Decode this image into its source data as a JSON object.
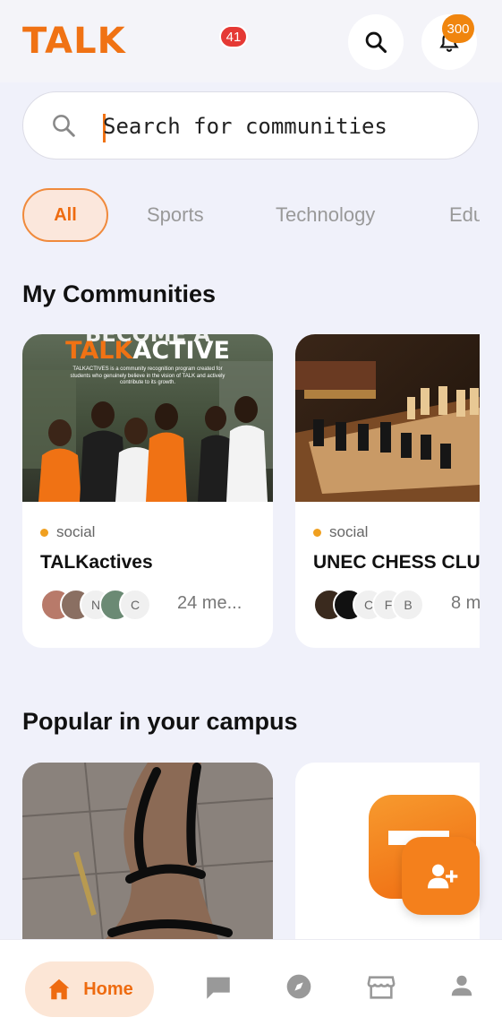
{
  "app": {
    "logo": "TALK"
  },
  "header": {
    "notification_count": "300"
  },
  "search": {
    "placeholder": "Search for communities"
  },
  "chips": [
    {
      "label": "All",
      "active": true
    },
    {
      "label": "Sports"
    },
    {
      "label": "Technology"
    },
    {
      "label": "Edu"
    }
  ],
  "sections": {
    "my_communities": "My Communities",
    "popular": "Popular in your campus"
  },
  "my_communities": [
    {
      "category": "social",
      "name": "TALKactives",
      "avatar_letters": [
        "",
        "",
        "N",
        "",
        "C"
      ],
      "members": "24 me...",
      "banner": {
        "line1": "BECOME A",
        "brand_a": "TALK",
        "brand_b": "ACTIVE",
        "blurb": "TALKACTIVES is a community recognition program created for students who genuinely believe in the vision of TALK and actively contribute to its growth."
      }
    },
    {
      "category": "social",
      "name": "UNEC CHESS CLUB",
      "avatar_letters": [
        "",
        "",
        "C",
        "F",
        "B"
      ],
      "members": "8 m"
    }
  ],
  "bottom_nav": {
    "home": "Home",
    "chat_badge": "41"
  },
  "colors": {
    "accent": "#f07214",
    "accent_light": "#fce6d6",
    "badge_red": "#e53935",
    "bg": "#f0f1fa"
  }
}
